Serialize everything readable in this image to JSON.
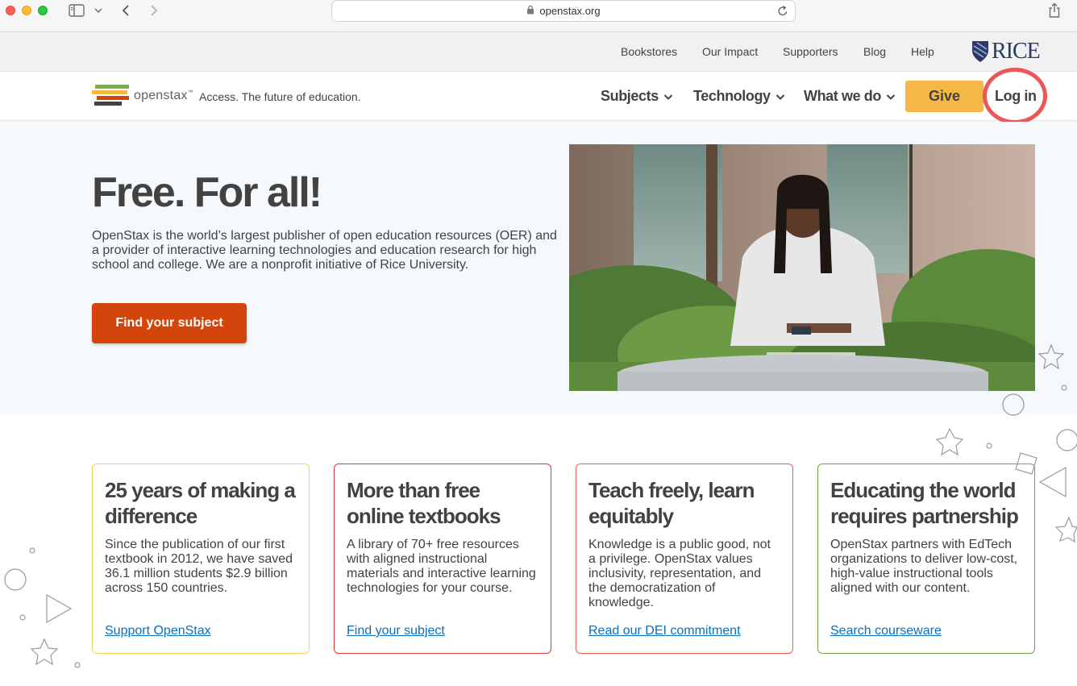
{
  "browser": {
    "url": "openstax.org"
  },
  "utility_nav": {
    "links": [
      "Bookstores",
      "Our Impact",
      "Supporters",
      "Blog",
      "Help"
    ],
    "partner_logo": "RICE"
  },
  "main_nav": {
    "logo_word": "openstax",
    "logo_tm": "™",
    "tagline": "Access. The future of education.",
    "items": [
      "Subjects",
      "Technology",
      "What we do"
    ],
    "give_label": "Give",
    "login_label": "Log in"
  },
  "hero": {
    "title": "Free. For all!",
    "body": "OpenStax is the world’s largest publisher of open education resources (OER) and a provider of interactive learning technologies and education research for high school and college. We are a nonprofit initiative of Rice University.",
    "cta_label": "Find your subject"
  },
  "cards": [
    {
      "title": "25 years of making a difference",
      "body": "Since the publication of our first textbook in 2012, we have saved 36.1 million students $2.9 billion across 150 countries.",
      "link": "Support OpenStax",
      "border_color": "#f1d35c"
    },
    {
      "title": "More than free online textbooks",
      "body": "A library of 70+ free resources with aligned instructional materials and interactive learning technologies for your course.",
      "link": "Find your subject",
      "border_color": "#d43a3a"
    },
    {
      "title": "Teach freely, learn equitably",
      "body": "Knowledge is a public good, not a privilege. OpenStax values inclusivity, representation, and the democratization of knowledge.",
      "link": "Read our DEI commitment",
      "border_color": "#e9624a"
    },
    {
      "title": "Educating the world requires partnership",
      "body": "OpenStax partners with EdTech organizations to deliver low-cost, high-value instructional tools aligned with our content.",
      "link": "Search courseware",
      "border_color": "#6fa344"
    }
  ],
  "colors": {
    "give": "#f4b944",
    "cta": "#d4450c",
    "link": "#0a6ebd",
    "annotation": "#ea5757"
  }
}
